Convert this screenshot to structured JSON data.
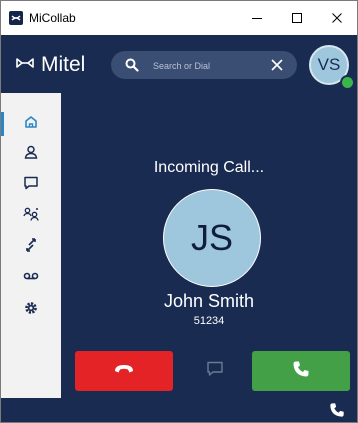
{
  "window": {
    "title": "MiCollab",
    "minimize_glyph": "—",
    "maximize_glyph": "☐",
    "close_glyph": "✕"
  },
  "header": {
    "brand": "Mitel",
    "search_placeholder": "Search or Dial",
    "user_initials": "VS",
    "presence_color": "#39b54a"
  },
  "sidebar": {
    "items": [
      {
        "name": "home",
        "icon": "home-icon",
        "active": true
      },
      {
        "name": "contacts",
        "icon": "person-icon"
      },
      {
        "name": "chat",
        "icon": "chat-icon"
      },
      {
        "name": "conferences",
        "icon": "people-icon"
      },
      {
        "name": "call-history",
        "icon": "call-history-icon"
      },
      {
        "name": "voicemail",
        "icon": "voicemail-icon"
      },
      {
        "name": "settings",
        "icon": "gear-icon"
      }
    ]
  },
  "call": {
    "status": "Incoming Call...",
    "caller_initials": "JS",
    "caller_name": "John Smith",
    "caller_number": "51234"
  },
  "colors": {
    "navy": "#1a2b52",
    "decline": "#e32326",
    "answer": "#43a047",
    "accent": "#2b86c6",
    "avatar": "#9ec6dc"
  }
}
